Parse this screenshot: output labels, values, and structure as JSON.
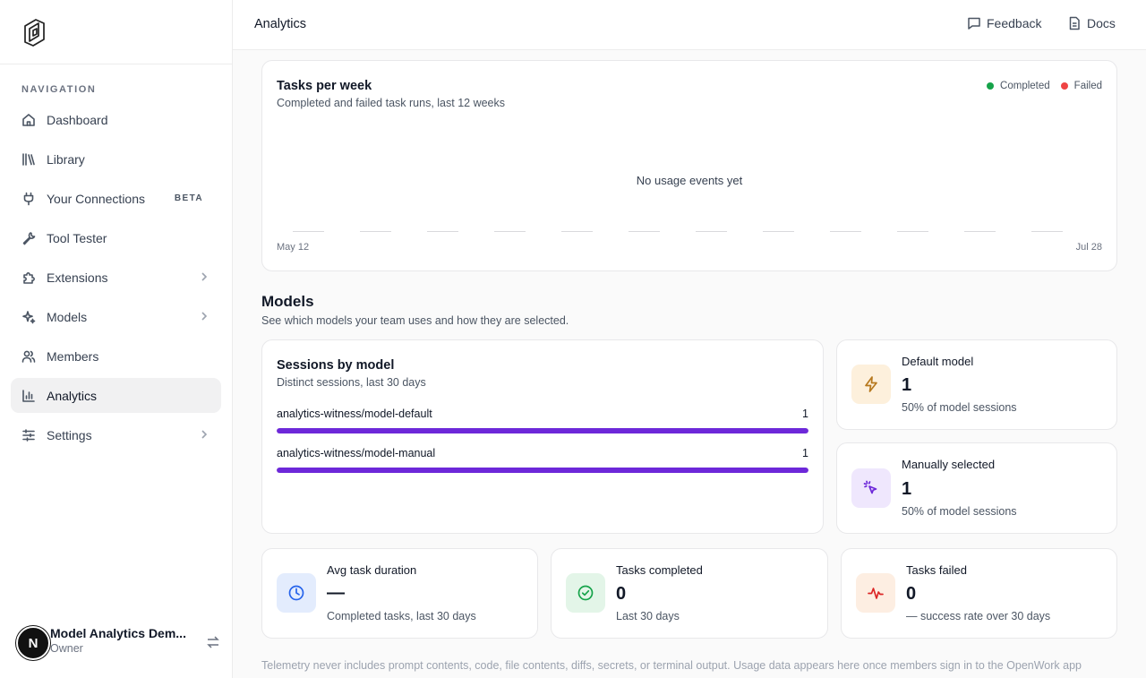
{
  "colors": {
    "accent": "#6d28d9",
    "completed": "#16a34a",
    "failed": "#ef4444",
    "active_nav_bg": "#f1f1f2"
  },
  "sidebar": {
    "logo_icon": "openwork-logo-icon",
    "nav_heading": "NAVIGATION",
    "items": [
      {
        "label": "Dashboard",
        "icon": "home-icon"
      },
      {
        "label": "Library",
        "icon": "library-icon"
      },
      {
        "label": "Your Connections",
        "icon": "plug-icon",
        "badge": "BETA"
      },
      {
        "label": "Tool Tester",
        "icon": "wrench-icon"
      },
      {
        "label": "Extensions",
        "icon": "puzzle-icon",
        "expandable": true
      },
      {
        "label": "Models",
        "icon": "sparkles-icon",
        "expandable": true
      },
      {
        "label": "Members",
        "icon": "users-icon"
      },
      {
        "label": "Analytics",
        "icon": "bar-chart-icon",
        "active": true
      },
      {
        "label": "Settings",
        "icon": "sliders-icon",
        "expandable": true
      }
    ],
    "user": {
      "avatar_letter": "N",
      "name": "Model Analytics Dem...",
      "role": "Owner"
    }
  },
  "header": {
    "title": "Analytics",
    "feedback_label": "Feedback",
    "docs_label": "Docs"
  },
  "tasks_chart": {
    "title": "Tasks per week",
    "subtitle": "Completed and failed task runs, last 12 weeks",
    "legend_completed": "Completed",
    "legend_failed": "Failed",
    "empty_message": "No usage events yet",
    "start_label": "May 12",
    "end_label": "Jul 28"
  },
  "chart_data": {
    "type": "bar",
    "title": "Tasks per week",
    "subtitle": "Completed and failed task runs, last 12 weeks",
    "x_start": "May 12",
    "x_end": "Jul 28",
    "weeks": 12,
    "series": [
      {
        "name": "Completed",
        "values": [
          0,
          0,
          0,
          0,
          0,
          0,
          0,
          0,
          0,
          0,
          0,
          0
        ]
      },
      {
        "name": "Failed",
        "values": [
          0,
          0,
          0,
          0,
          0,
          0,
          0,
          0,
          0,
          0,
          0,
          0
        ]
      }
    ],
    "legend": "top-right"
  },
  "models_section": {
    "title": "Models",
    "subtitle": "See which models your team uses and how they are selected."
  },
  "sessions": {
    "title": "Sessions by model",
    "subtitle": "Distinct sessions, last 30 days",
    "rows": [
      {
        "name": "analytics-witness/model-default",
        "count": "1",
        "share": 1.0
      },
      {
        "name": "analytics-witness/model-manual",
        "count": "1",
        "share": 1.0
      }
    ]
  },
  "default_model": {
    "title": "Default model",
    "value": "1",
    "sub": "50% of model sessions",
    "icon": "lightning-icon"
  },
  "manual_model": {
    "title": "Manually selected",
    "value": "1",
    "sub": "50% of model sessions",
    "icon": "cursor-click-icon"
  },
  "avg_duration": {
    "title": "Avg task duration",
    "value": "—",
    "sub": "Completed tasks, last 30 days",
    "icon": "clock-icon"
  },
  "tasks_completed": {
    "title": "Tasks completed",
    "value": "0",
    "sub": "Last 30 days",
    "icon": "check-circle-icon"
  },
  "tasks_failed": {
    "title": "Tasks failed",
    "value": "0",
    "sub": "— success rate over 30 days",
    "icon": "activity-icon"
  },
  "footer_note": "Telemetry never includes prompt contents, code, file contents, diffs, secrets, or terminal output. Usage data appears here once members sign in to the OpenWork app"
}
